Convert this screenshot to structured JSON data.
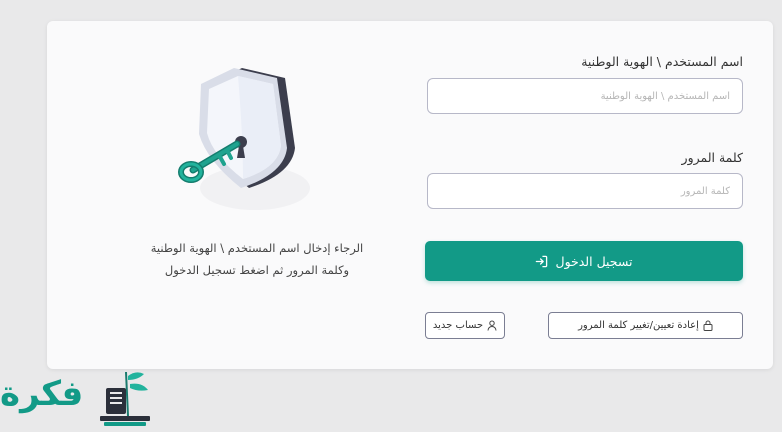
{
  "form": {
    "username_label": "اسم المستخدم \\ الهوية الوطنية",
    "username_placeholder": "اسم المستخدم \\ الهوية الوطنية",
    "password_label": "كلمة المرور",
    "password_placeholder": "كلمة المرور",
    "login_label": "تسجيل الدخول",
    "reset_label": "إعادة تعيين/تغيير كلمة المرور",
    "register_label": "حساب جديد"
  },
  "instructions": {
    "line1": "الرجاء إدخال اسم المستخدم \\ الهوية الوطنية",
    "line2": "وكلمة المرور ثم اضغط تسجيل الدخول"
  },
  "watermark": {
    "text": "فكرة"
  },
  "icons": {
    "login": "sign-in-icon",
    "reset": "lock-icon",
    "register": "user-icon",
    "illustration": "shield-key-illustration"
  },
  "colors": {
    "accent": "#129a87",
    "background": "#e9e9ea",
    "card": "#fafafb"
  }
}
